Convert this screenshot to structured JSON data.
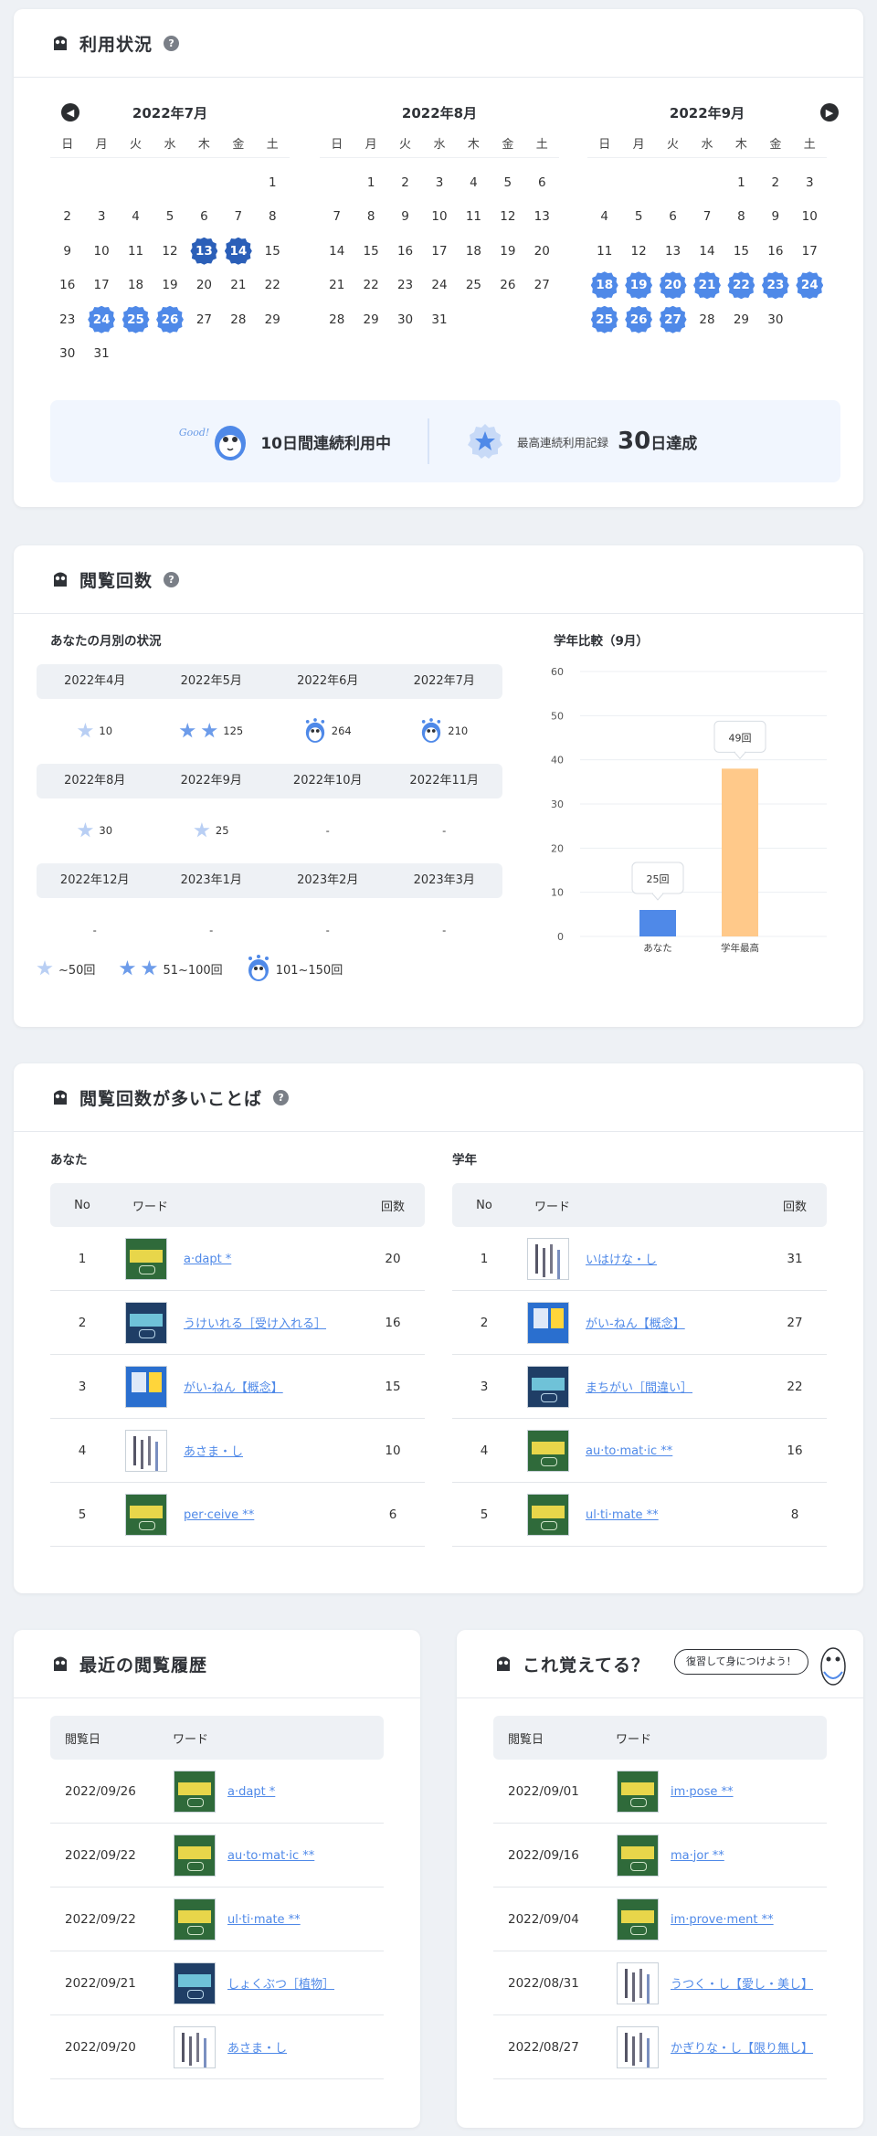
{
  "usage": {
    "title": "利用状況",
    "help": "?",
    "weekdays": [
      "日",
      "月",
      "火",
      "水",
      "木",
      "金",
      "土"
    ],
    "months": [
      {
        "title": "2022年7月",
        "offset": 6,
        "days": 31,
        "marked": {
          "13": "navy",
          "14": "navy",
          "24": "blue",
          "25": "blue",
          "26": "blue"
        }
      },
      {
        "title": "2022年8月",
        "offset": 1,
        "days": 31,
        "marked": {}
      },
      {
        "title": "2022年9月",
        "offset": 4,
        "days": 30,
        "marked": {
          "18": "blue",
          "19": "blue",
          "20": "blue",
          "21": "blue",
          "22": "blue",
          "23": "blue",
          "24": "blue",
          "25": "blue",
          "26": "blue",
          "27": "blue"
        }
      }
    ],
    "streak": {
      "good": "Good!",
      "current": "10日間連続利用中",
      "record_label": "最高連続利用記録",
      "record_num": "30",
      "record_unit": "日達成"
    }
  },
  "views": {
    "title": "閲覧回数",
    "help": "?",
    "monthly_title": "あなたの月別の状況",
    "rows": [
      [
        {
          "m": "2022年4月",
          "icon": "star-1",
          "v": "10"
        },
        {
          "m": "2022年5月",
          "icon": "star-2",
          "v": "125"
        },
        {
          "m": "2022年6月",
          "icon": "owl",
          "v": "264"
        },
        {
          "m": "2022年7月",
          "icon": "owl",
          "v": "210"
        }
      ],
      [
        {
          "m": "2022年8月",
          "icon": "star-1",
          "v": "30"
        },
        {
          "m": "2022年9月",
          "icon": "star-1",
          "v": "25"
        },
        {
          "m": "2022年10月",
          "icon": "",
          "v": "-"
        },
        {
          "m": "2022年11月",
          "icon": "",
          "v": "-"
        }
      ],
      [
        {
          "m": "2022年12月",
          "icon": "",
          "v": "-"
        },
        {
          "m": "2023年1月",
          "icon": "",
          "v": "-"
        },
        {
          "m": "2023年2月",
          "icon": "",
          "v": "-"
        },
        {
          "m": "2023年3月",
          "icon": "",
          "v": "-"
        }
      ]
    ],
    "legend": [
      "~50回",
      "51~100回",
      "101~150回"
    ],
    "compare_title": "学年比較（9月）"
  },
  "chart_data": {
    "type": "bar",
    "categories": [
      "あなた",
      "学年最高"
    ],
    "values": [
      6,
      38
    ],
    "data_labels": [
      "25回",
      "49回"
    ],
    "colors": [
      "#4f89e8",
      "#ffc98a"
    ],
    "ylim": [
      0,
      60
    ],
    "yticks": [
      0,
      10,
      20,
      30,
      40,
      50,
      60
    ],
    "grid": true
  },
  "frequent": {
    "title": "閲覧回数が多いことば",
    "help": "?",
    "you_title": "あなた",
    "grade_title": "学年",
    "headers": {
      "no": "No",
      "word": "ワード",
      "count": "回数"
    },
    "you": [
      {
        "no": "1",
        "book": "genius",
        "word": "a·dapt *",
        "count": "20"
      },
      {
        "no": "2",
        "book": "navy",
        "word": "うけいれる［受け入れる］",
        "count": "16"
      },
      {
        "no": "3",
        "book": "meikyo",
        "word": "がい-ねん【概念】",
        "count": "15"
      },
      {
        "no": "4",
        "book": "kogo",
        "word": "あさま・し",
        "count": "10"
      },
      {
        "no": "5",
        "book": "genius",
        "word": "per·ceive **",
        "count": "6"
      }
    ],
    "grade": [
      {
        "no": "1",
        "book": "kogo",
        "word": "いはけな・し",
        "count": "31"
      },
      {
        "no": "2",
        "book": "meikyo",
        "word": "がい-ねん【概念】",
        "count": "27"
      },
      {
        "no": "3",
        "book": "navy",
        "word": "まちがい［間違い］",
        "count": "22"
      },
      {
        "no": "4",
        "book": "genius",
        "word": "au·to·mat·ic **",
        "count": "16"
      },
      {
        "no": "5",
        "book": "genius",
        "word": "ul·ti·mate **",
        "count": "8"
      }
    ]
  },
  "recent": {
    "title": "最近の閲覧履歴",
    "headers": {
      "date": "閲覧日",
      "word": "ワード"
    },
    "rows": [
      {
        "date": "2022/09/26",
        "book": "genius",
        "word": "a·dapt *"
      },
      {
        "date": "2022/09/22",
        "book": "genius",
        "word": "au·to·mat·ic **"
      },
      {
        "date": "2022/09/22",
        "book": "genius",
        "word": "ul·ti·mate **"
      },
      {
        "date": "2022/09/21",
        "book": "navy",
        "word": "しょくぶつ［植物］"
      },
      {
        "date": "2022/09/20",
        "book": "kogo",
        "word": "あさま・し"
      }
    ]
  },
  "remember": {
    "title": "これ覚えてる？",
    "bubble": "復習して身につけよう！",
    "headers": {
      "date": "閲覧日",
      "word": "ワード"
    },
    "rows": [
      {
        "date": "2022/09/01",
        "book": "genius",
        "word": "im·pose **"
      },
      {
        "date": "2022/09/16",
        "book": "genius",
        "word": "ma·jor **"
      },
      {
        "date": "2022/09/04",
        "book": "genius",
        "word": "im·prove·ment **"
      },
      {
        "date": "2022/08/31",
        "book": "kogo",
        "word": "うつく・し【愛し・美し】"
      },
      {
        "date": "2022/08/27",
        "book": "kogo",
        "word": "かぎりな・し【限り無し】"
      }
    ]
  }
}
